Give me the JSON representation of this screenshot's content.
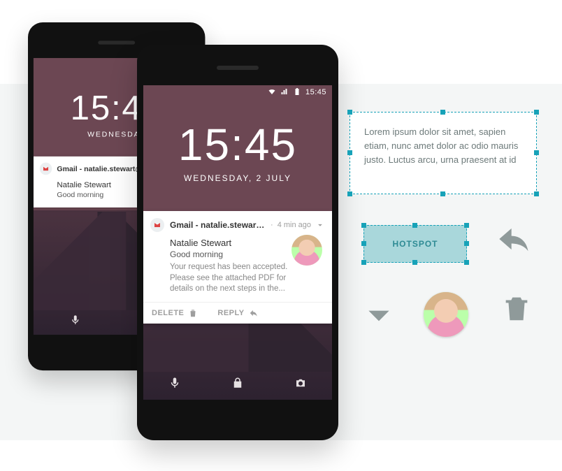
{
  "statusbar": {
    "time": "15:45"
  },
  "lockscreen": {
    "time": "15:45",
    "date_full": "WEDNESDAY, 2 JULY",
    "date_short": "WEDNESDAY"
  },
  "notification": {
    "title_full": "Gmail - natalie.stewart@gmail.com",
    "title_trunc": "Gmail - natalie.stewart@g",
    "meta": "4 min ago",
    "sender": "Natalie Stewart",
    "subject": "Good morning",
    "preview": "Your request has been accepted. Please see the attached PDF for details on the next steps in the...",
    "actions": {
      "delete": "DELETE",
      "reply": "REPLY"
    }
  },
  "editor": {
    "lorem": "Lorem ipsum dolor sit amet, sapien etiam, nunc amet dolor ac odio mauris justo. Luctus arcu, urna praesent at id",
    "hotspot_label": "HOTSPOT"
  }
}
